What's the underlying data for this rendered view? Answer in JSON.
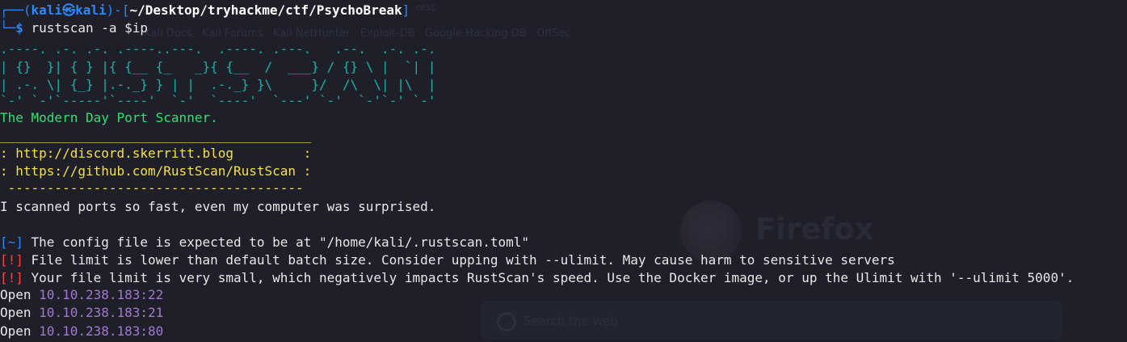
{
  "background_text": {
    "bookmarks": "  Kali Docs   Kali Forums   Kali NetHunter   Exploit-DB   Google Hacking DB   OffSec",
    "top_fragment": "ress",
    "brand": "Firefox",
    "search_placeholder": "Search the web"
  },
  "prompt": {
    "corner_top": "┌──(",
    "user": "kali",
    "at": "㉿",
    "host": "kali",
    "mid": ")-[",
    "path": "~/Desktop/tryhackme/ctf/PsychoBreak",
    "close": "]",
    "corner_bottom": "└─",
    "dollar": "$",
    "command": " rustscan -a $ip"
  },
  "banner": {
    "row1": ".----. .-. .-. .----..---.  .----. .---.   .--.  .-. .-.",
    "row2": "| {}  }| { } |{ {__ {_   _}{ {__  /  ___} / {} \\ |  `| |",
    "row3": "| .-. \\| {_} |.-._} } | |  .-._} }\\     }/  /\\  \\| |\\  |",
    "row4": "`-' `-'`-----'`----'  `-'  `----'  `---' `-'  `-'`-' `-'",
    "tagline": "The Modern Day Port Scanner."
  },
  "links": {
    "top_rule": "________________________________________",
    "discord": ": http://discord.skerritt.blog         :",
    "github": ": https://github.com/RustScan/RustScan :",
    "bottom_rule": " --------------------------------------"
  },
  "joke": "I scanned ports so fast, even my computer was surprised.",
  "messages": [
    {
      "tag": "[~]",
      "text": " The config file is expected to be at \"/home/kali/.rustscan.toml\""
    },
    {
      "tag": "[!]",
      "text": " File limit is lower than default batch size. Consider upping with --ulimit. May cause harm to sensitive servers"
    },
    {
      "tag": "[!]",
      "text": " Your file limit is very small, which negatively impacts RustScan's speed. Use the Docker image, or up the Ulimit with '--ulimit 5000'."
    }
  ],
  "open_ports": [
    {
      "label": "Open ",
      "addr": "10.10.238.183:22"
    },
    {
      "label": "Open ",
      "addr": "10.10.238.183:21"
    },
    {
      "label": "Open ",
      "addr": "10.10.238.183:80"
    }
  ],
  "colors": {
    "background": "#1e1f29",
    "prompt_blue": "#2f86f5",
    "teal": "#18b2a6",
    "green": "#2fe06f",
    "yellow": "#f4e04a",
    "red": "#ff4444",
    "purple": "#a07ad0"
  }
}
